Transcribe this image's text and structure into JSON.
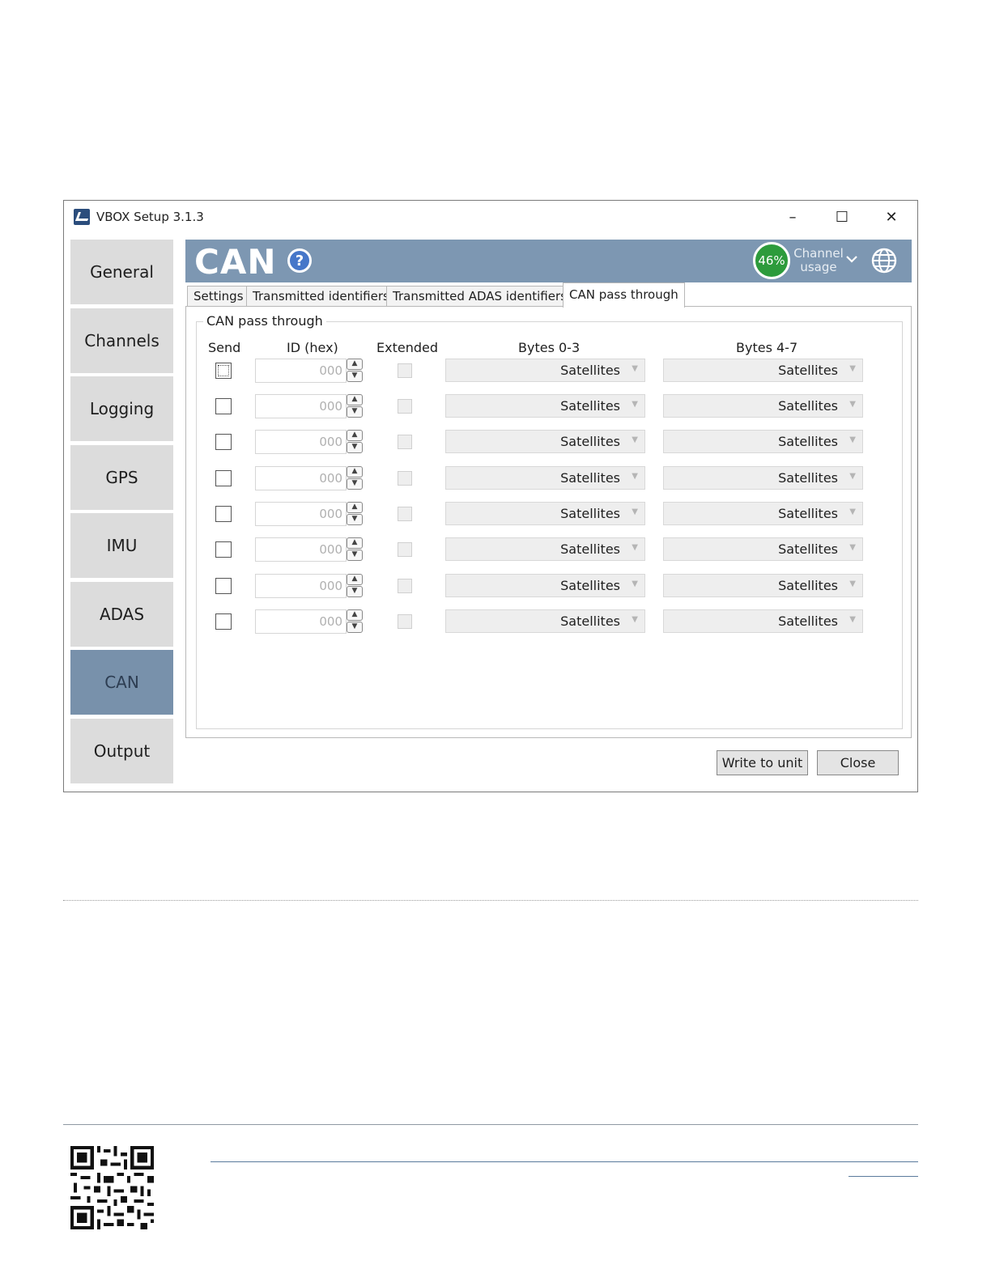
{
  "window": {
    "title": "VBOX Setup 3.1.3",
    "controls": {
      "minimize": "–",
      "maximize": "☐",
      "close": "✕"
    }
  },
  "sidebar": {
    "items": [
      {
        "label": "General"
      },
      {
        "label": "Channels"
      },
      {
        "label": "Logging"
      },
      {
        "label": "GPS"
      },
      {
        "label": "IMU"
      },
      {
        "label": "ADAS"
      },
      {
        "label": "CAN",
        "active": true
      },
      {
        "label": "Output"
      }
    ]
  },
  "header": {
    "title": "CAN",
    "help_glyph": "?",
    "usage_value": "46%",
    "usage_label_line1": "Channel",
    "usage_label_line2": "usage",
    "accent_color": "#7d97b2",
    "usage_color": "#2d9b3c"
  },
  "tabs": [
    {
      "label": "Settings"
    },
    {
      "label": "Transmitted identifiers"
    },
    {
      "label": "Transmitted ADAS identifiers"
    },
    {
      "label": "CAN pass through",
      "active": true
    }
  ],
  "group": {
    "title": "CAN pass through",
    "columns": {
      "send": "Send",
      "id": "ID (hex)",
      "extended": "Extended",
      "bytes03": "Bytes 0-3",
      "bytes47": "Bytes 4-7"
    }
  },
  "rows": [
    {
      "send": false,
      "id": "000",
      "extended": false,
      "bytes03": "Satellites",
      "bytes47": "Satellites"
    },
    {
      "send": false,
      "id": "000",
      "extended": false,
      "bytes03": "Satellites",
      "bytes47": "Satellites"
    },
    {
      "send": false,
      "id": "000",
      "extended": false,
      "bytes03": "Satellites",
      "bytes47": "Satellites"
    },
    {
      "send": false,
      "id": "000",
      "extended": false,
      "bytes03": "Satellites",
      "bytes47": "Satellites"
    },
    {
      "send": false,
      "id": "000",
      "extended": false,
      "bytes03": "Satellites",
      "bytes47": "Satellites"
    },
    {
      "send": false,
      "id": "000",
      "extended": false,
      "bytes03": "Satellites",
      "bytes47": "Satellites"
    },
    {
      "send": false,
      "id": "000",
      "extended": false,
      "bytes03": "Satellites",
      "bytes47": "Satellites"
    },
    {
      "send": false,
      "id": "000",
      "extended": false,
      "bytes03": "Satellites",
      "bytes47": "Satellites"
    }
  ],
  "buttons": {
    "write": "Write to unit",
    "close": "Close"
  },
  "icons": {
    "app": "vbox-app-icon",
    "help": "help-icon",
    "globe": "globe-icon",
    "dropdown": "chevron-down-icon",
    "spinner": "spinner-arrows-icon",
    "qr": "qr-code-icon"
  }
}
